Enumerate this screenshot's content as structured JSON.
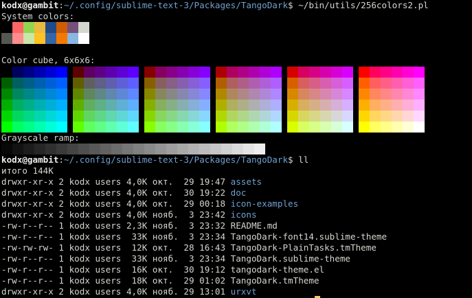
{
  "terminal": {
    "prompt1": {
      "user_host": "kodx@gambit",
      "sep": ":",
      "path": "~/.config/sublime-text-3/Packages/TangoDark",
      "command": "$ ~/bin/utils/256colors2.pl"
    },
    "system_label": "System colors:",
    "system_colors_row1": [
      "#000000",
      "#ff6565",
      "#93d44f",
      "#eab93d",
      "#204a87",
      "#ce5c00",
      "#75507b",
      "#d3d7cf"
    ],
    "system_colors_row2": [
      "#555753",
      "#ff8d8d",
      "#c8e7a8",
      "#ffc123",
      "#3465a4",
      "#f57900",
      "#89b6e2",
      "#ffffff"
    ],
    "cube_label": "Color cube, 6x6x6:",
    "grayscale_label": "Grayscale ramp:",
    "prompt2": {
      "user_host": "kodx@gambit",
      "sep": ":",
      "path": "~/.config/sublime-text-3/Packages/TangoDark",
      "command": "$ ll"
    },
    "total": "итого 144K",
    "listing": [
      {
        "meta": "drwxr-xr-x 2 kodx users 4,0K окт.  29 19:47 ",
        "name": "assets",
        "is_dir": true
      },
      {
        "meta": "drwxr-xr-x 2 kodx users 4,0K окт.  30 19:22 ",
        "name": "doc",
        "is_dir": true
      },
      {
        "meta": "drwxr-xr-x 2 kodx users 4,0K окт.  29 00:18 ",
        "name": "icon-examples",
        "is_dir": true
      },
      {
        "meta": "drwxr-xr-x 2 kodx users 4,0K нояб.  3 23:42 ",
        "name": "icons",
        "is_dir": true
      },
      {
        "meta": "-rw-r--r-- 1 kodx users 2,3K нояб.  3 23:32 ",
        "name": "README.md",
        "is_dir": false
      },
      {
        "meta": "-rw-r--r-- 1 kodx users  33K нояб.  3 23:34 ",
        "name": "TangoDark-font14.sublime-theme",
        "is_dir": false
      },
      {
        "meta": "-rw-rw-rw- 1 kodx users  12K окт.  28 16:43 ",
        "name": "TangoDark-PlainTasks.tmTheme",
        "is_dir": false
      },
      {
        "meta": "-rw-r--r-- 1 kodx users  33K нояб.  3 23:34 ",
        "name": "TangoDark.sublime-theme",
        "is_dir": false
      },
      {
        "meta": "-rw-r--r-- 1 kodx users  16K окт.  30 19:12 ",
        "name": "tangodark-theme.el",
        "is_dir": false
      },
      {
        "meta": "-rw-r--r-- 1 kodx users  18K окт.  29 01:02 ",
        "name": "TangoDark.tmTheme",
        "is_dir": false
      },
      {
        "meta": "drwxr-xr-x 2 kodx users 4,0K нояб. 29 13:01 ",
        "name": "urxvt",
        "is_dir": true
      }
    ],
    "colors": {
      "background": "#000000",
      "foreground": "#d3d7cf",
      "path": "#729fcf",
      "directory": "#729fcf",
      "cursor": "#f0c674"
    }
  }
}
